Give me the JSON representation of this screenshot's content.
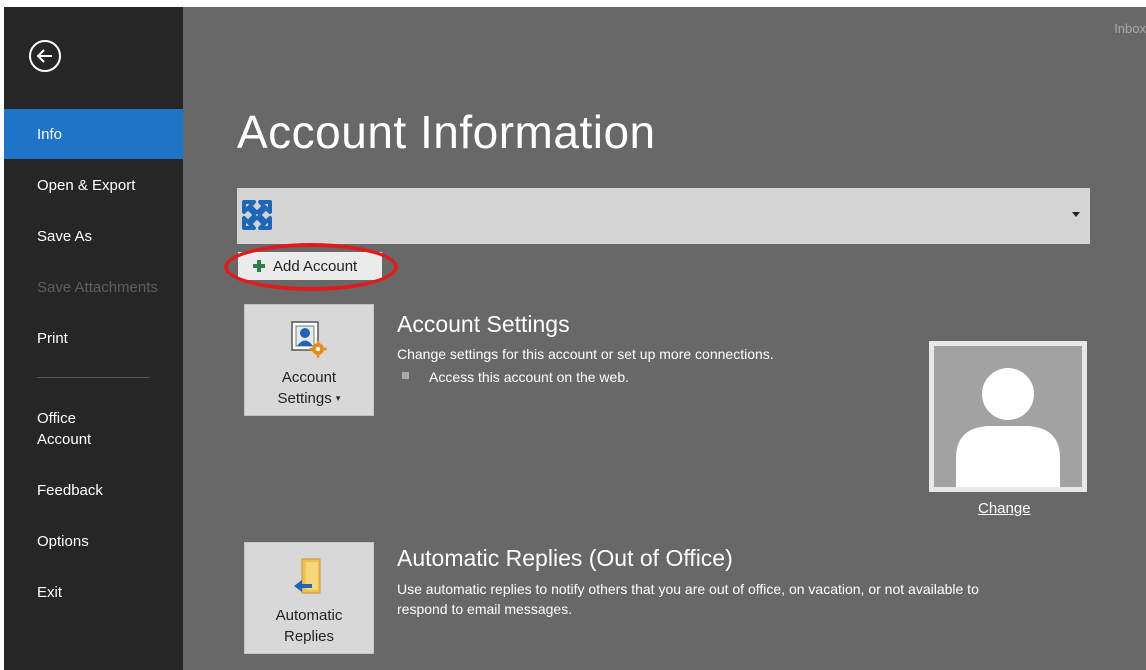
{
  "window": {
    "inbox_label": "Inbox"
  },
  "sidebar": {
    "items": [
      {
        "label": "Info",
        "state": "active"
      },
      {
        "label": "Open & Export",
        "state": "normal"
      },
      {
        "label": "Save As",
        "state": "normal"
      },
      {
        "label": "Save Attachments",
        "state": "disabled"
      },
      {
        "label": "Print",
        "state": "normal"
      },
      {
        "label": "Office Account",
        "line1": "Office",
        "line2": "Account",
        "state": "normal"
      },
      {
        "label": "Feedback",
        "state": "normal"
      },
      {
        "label": "Options",
        "state": "normal"
      },
      {
        "label": "Exit",
        "state": "normal"
      }
    ]
  },
  "main": {
    "title": "Account Information",
    "account_selector": {
      "value": "",
      "icon": "exchange-icon"
    },
    "add_account_label": "Add Account",
    "account_settings": {
      "tile_line1": "Account",
      "tile_line2": "Settings",
      "title": "Account Settings",
      "description": "Change settings for this account or set up more connections.",
      "bullet": "Access this account on the web."
    },
    "profile_photo": {
      "change_label": "Change"
    },
    "automatic_replies": {
      "tile_line1": "Automatic",
      "tile_line2": "Replies",
      "title": "Automatic Replies (Out of Office)",
      "description_line1": "Use automatic replies to notify others that you are out of office, on vacation, or not available to",
      "description_line2": "respond to email messages."
    }
  },
  "colors": {
    "sidebar_bg": "#262626",
    "active_blue": "#1e74c6",
    "content_bg": "#686868",
    "highlight_red": "#e11b1b"
  }
}
